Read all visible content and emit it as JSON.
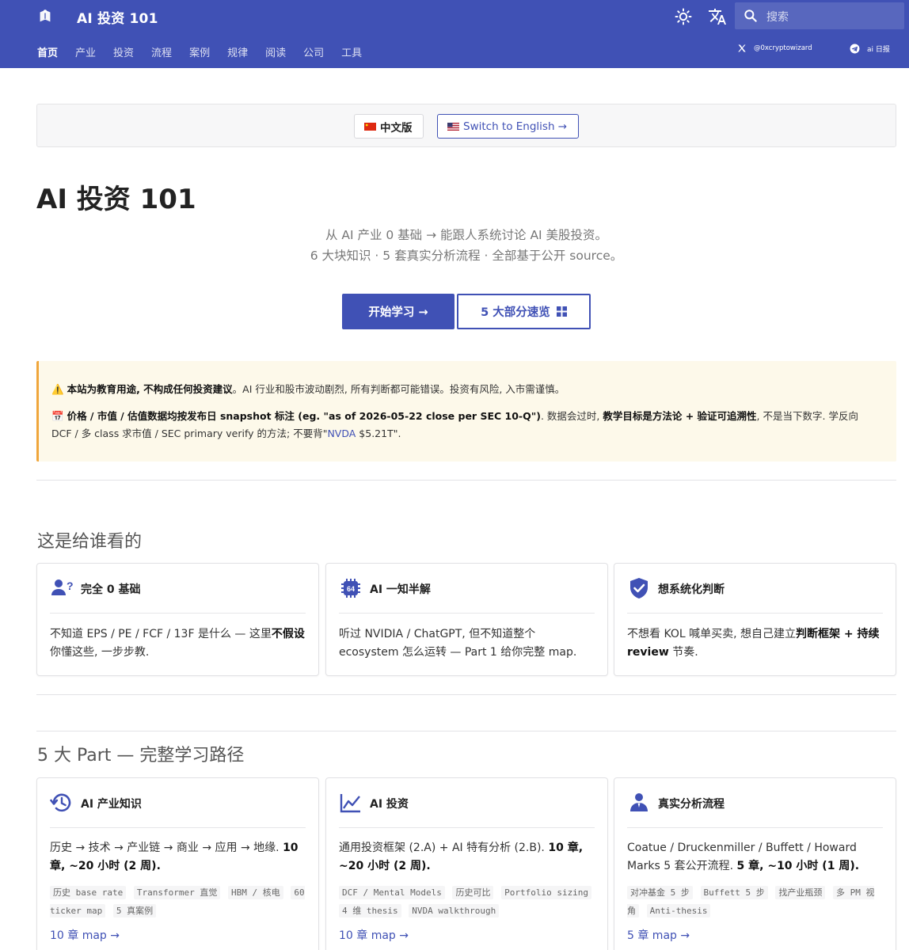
{
  "header": {
    "site_title": "AI 投资 101",
    "search_placeholder": "搜索",
    "tabs": [
      "首页",
      "产业",
      "投资",
      "流程",
      "案例",
      "规律",
      "阅读",
      "公司",
      "工具"
    ],
    "social_x": "@0xcryptowizard",
    "social_tg": "ai 日报",
    "brand_color": "#4051b5"
  },
  "lang": {
    "zh": "中文版",
    "en": "Switch to English →"
  },
  "page_title": "AI 投资 101",
  "hero": {
    "line1": "从 AI 产业 0 基础 → 能跟人系统讨论 AI 美股投资。",
    "line2": "6 大块知识 · 5 套真实分析流程 · 全部基于公开 source。",
    "btn_start": "开始学习 →",
    "btn_overview": "5 大部分速览"
  },
  "warning": {
    "line1_bold": "本站为教育用途, 不构成任何投资建议",
    "line1_rest": "。AI 行业和股市波动剧烈, 所有判断都可能错误。投资有风险, 入市需谨慎。",
    "line2_bold1": "价格 / 市值 / 估值数据均按发布日 snapshot 标注 (eg. \"as of 2026-05-22 close per SEC 10-Q\")",
    "line2_mid": ". 数据会过时, ",
    "line2_bold2": "教学目标是方法论 + 验证可追溯性",
    "line2_rest": ", 不是当下数字. 学反向",
    "line3_pre": "DCF / 多 class 求市值 / SEC primary verify 的方法; 不要背\"",
    "line3_link": "NVDA",
    "line3_post": " $5.21T\"."
  },
  "audience": {
    "title": "这是给谁看的",
    "cards": [
      {
        "icon": "user-question-icon",
        "title": "完全 0 基础",
        "body_pre": "不知道 EPS / PE / FCF / 13F 是什么 — 这里",
        "body_bold": "不假设",
        "body_post": "你懂这些, 一步步教."
      },
      {
        "icon": "chip-64-icon",
        "title": "AI 一知半解",
        "body_pre": "听过 NVIDIA / ChatGPT, 但不知道整个 ecosystem 怎么运转 — Part 1 给你完整 map.",
        "body_bold": "",
        "body_post": ""
      },
      {
        "icon": "shield-check-icon",
        "title": "想系统化判断",
        "body_pre": "不想看 KOL 喊单买卖, 想自己建立",
        "body_bold": "判断框架 + 持续 review",
        "body_post": " 节奏."
      }
    ]
  },
  "parts": {
    "title": "5 大 Part — 完整学习路径",
    "cards": [
      {
        "icon": "history-icon",
        "title": "AI 产业知识",
        "body_pre": "历史 → 技术 → 产业链 → 商业 → 应用 → 地缘. ",
        "body_bold": "10 章, ~20 小时 (2 周).",
        "tags": [
          "历史 base rate",
          "Transformer 直觉",
          "HBM / 核电",
          "60 ticker map",
          "5 真案例"
        ],
        "link": "10 章 map →"
      },
      {
        "icon": "chart-line-icon",
        "title": "AI 投资",
        "body_pre": "通用投资框架 (2.A) + AI 特有分析 (2.B). ",
        "body_bold": "10 章, ~20 小时 (2 周).",
        "tags": [
          "DCF / Mental Models",
          "历史可比",
          "Portfolio sizing",
          "4 维 thesis",
          "NVDA walkthrough"
        ],
        "link": "10 章 map →"
      },
      {
        "icon": "investor-icon",
        "title": "真实分析流程",
        "body_pre": "Coatue / Druckenmiller / Buffett / Howard Marks 5 套公开流程. ",
        "body_bold": "5 章, ~10 小时 (1 周).",
        "tags": [
          "对冲基金 5 步",
          "Buffett 5 步",
          "找产业瓶颈",
          "多 PM 视角",
          "Anti-thesis"
        ],
        "link": "5 章 map →"
      }
    ]
  }
}
